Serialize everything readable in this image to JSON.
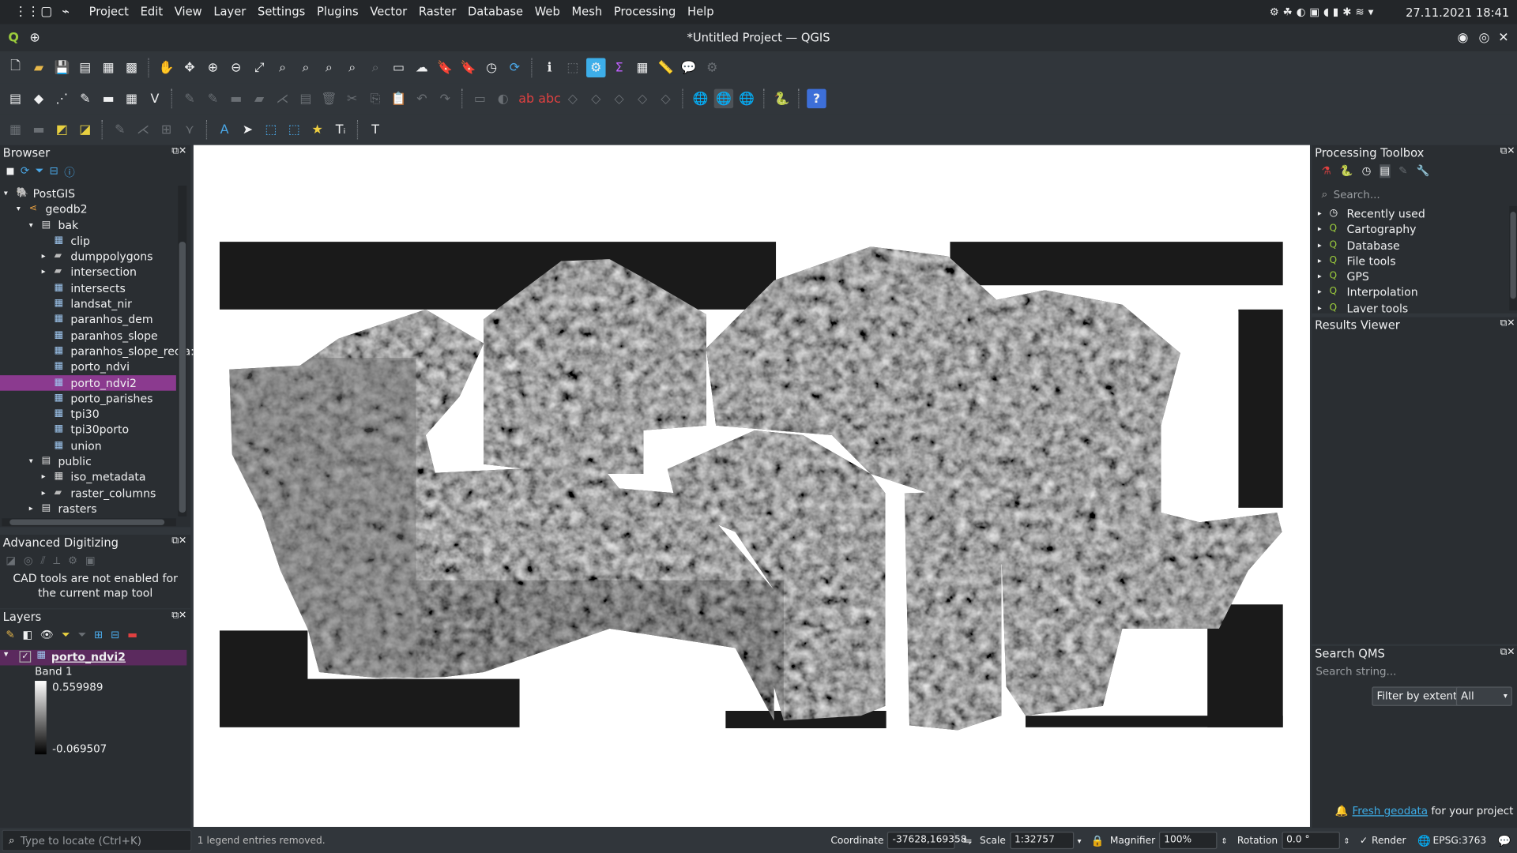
{
  "system": {
    "menu": [
      "Project",
      "Edit",
      "View",
      "Layer",
      "Settings",
      "Plugins",
      "Vector",
      "Raster",
      "Database",
      "Web",
      "Mesh",
      "Processing",
      "Help"
    ],
    "clock": "27.11.2021  18:41"
  },
  "window": {
    "title": "*Untitled Project — QGIS"
  },
  "browser": {
    "title": "Browser",
    "items": [
      {
        "label": "PostGIS",
        "level": 0,
        "icon": "postgis-icon",
        "expander": "open"
      },
      {
        "label": "geodb2",
        "level": 1,
        "icon": "db-connection-icon",
        "expander": "open"
      },
      {
        "label": "bak",
        "level": 2,
        "icon": "schema-icon",
        "expander": "open"
      },
      {
        "label": "clip",
        "level": 3,
        "icon": "raster-layer-icon",
        "expander": ""
      },
      {
        "label": "dumppolygons",
        "level": 3,
        "icon": "polygon-layer-icon",
        "expander": "closed"
      },
      {
        "label": "intersection",
        "level": 3,
        "icon": "polygon-layer-icon",
        "expander": "closed"
      },
      {
        "label": "intersects",
        "level": 3,
        "icon": "raster-layer-icon",
        "expander": ""
      },
      {
        "label": "landsat_nir",
        "level": 3,
        "icon": "raster-layer-icon",
        "expander": ""
      },
      {
        "label": "paranhos_dem",
        "level": 3,
        "icon": "raster-layer-icon",
        "expander": ""
      },
      {
        "label": "paranhos_slope",
        "level": 3,
        "icon": "raster-layer-icon",
        "expander": ""
      },
      {
        "label": "paranhos_slope_recla:",
        "level": 3,
        "icon": "raster-layer-icon",
        "expander": ""
      },
      {
        "label": "porto_ndvi",
        "level": 3,
        "icon": "raster-layer-icon",
        "expander": ""
      },
      {
        "label": "porto_ndvi2",
        "level": 3,
        "icon": "raster-layer-icon",
        "expander": "",
        "selected": true
      },
      {
        "label": "porto_parishes",
        "level": 3,
        "icon": "raster-layer-icon",
        "expander": ""
      },
      {
        "label": "tpi30",
        "level": 3,
        "icon": "raster-layer-icon",
        "expander": ""
      },
      {
        "label": "tpi30porto",
        "level": 3,
        "icon": "raster-layer-icon",
        "expander": ""
      },
      {
        "label": "union",
        "level": 3,
        "icon": "raster-layer-icon",
        "expander": ""
      },
      {
        "label": "public",
        "level": 2,
        "icon": "schema-icon",
        "expander": "open"
      },
      {
        "label": "iso_metadata",
        "level": 3,
        "icon": "table-icon",
        "expander": "closed"
      },
      {
        "label": "raster_columns",
        "level": 3,
        "icon": "polygon-layer-icon",
        "expander": "closed"
      },
      {
        "label": "rasters",
        "level": 2,
        "icon": "schema-icon",
        "expander": "closed"
      }
    ]
  },
  "adv_digitizing": {
    "title": "Advanced Digitizing",
    "message": "CAD tools are not enabled for the current map tool"
  },
  "layers": {
    "title": "Layers",
    "layer_name": "porto_ndvi2",
    "band": "Band 1",
    "max": "0.559989",
    "min": "-0.069507",
    "checked": true
  },
  "processing": {
    "title": "Processing Toolbox",
    "search_placeholder": "Search...",
    "items": [
      "Recently used",
      "Cartography",
      "Database",
      "File tools",
      "GPS",
      "Interpolation",
      "Layer tools"
    ]
  },
  "results": {
    "title": "Results Viewer"
  },
  "qms": {
    "title": "Search QMS",
    "placeholder": "Search string...",
    "filter_btn": "Filter by extent",
    "filter_sel": "All",
    "footer_link": "Fresh geodata",
    "footer_text": " for your project"
  },
  "status": {
    "locator_placeholder": "Type to locate (Ctrl+K)",
    "message": "1 legend entries removed.",
    "coord_label": "Coordinate",
    "coord_value": "-37628,169358",
    "scale_label": "Scale",
    "scale_value": "1:32757",
    "magnifier_label": "Magnifier",
    "magnifier_value": "100%",
    "rotation_label": "Rotation",
    "rotation_value": "0.0 °",
    "render_label": "Render",
    "crs": "EPSG:3763"
  }
}
